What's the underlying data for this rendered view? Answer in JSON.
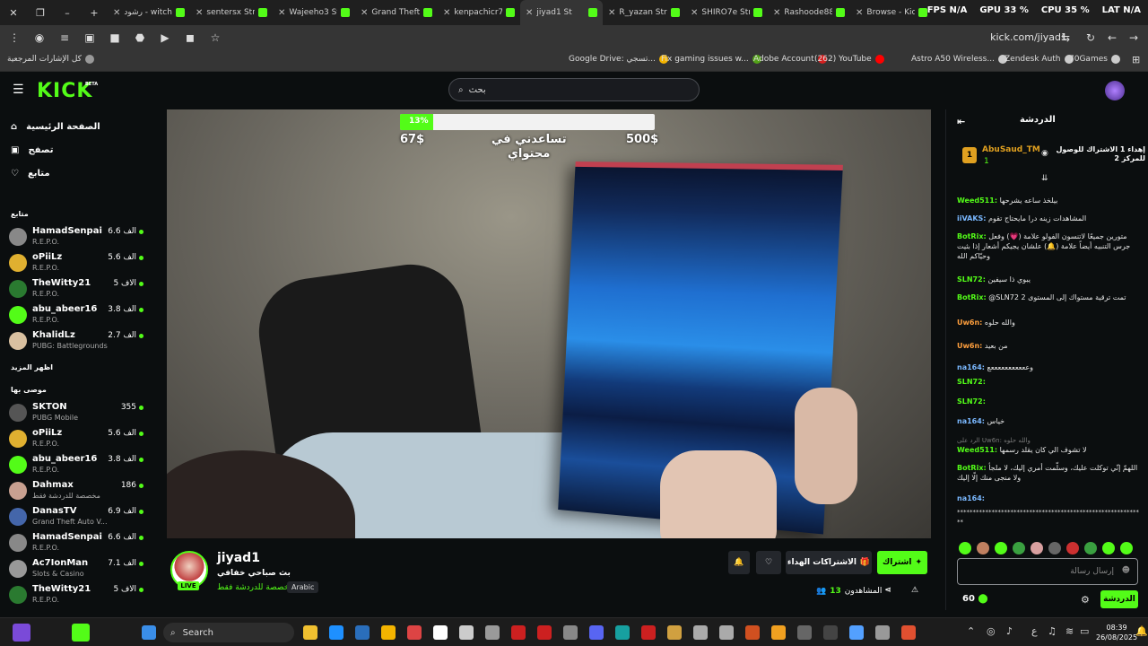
{
  "browser": {
    "tabs": [
      {
        "label": "رشود - witch",
        "active": false
      },
      {
        "label": "sentersx Stre",
        "active": false
      },
      {
        "label": "Wajeeho3 St",
        "active": false
      },
      {
        "label": "Grand Theft",
        "active": false
      },
      {
        "label": "kenpachicr7",
        "active": false
      },
      {
        "label": "jiyad1 St",
        "active": true
      },
      {
        "label": "R_yazan Stre",
        "active": false
      },
      {
        "label": "SHIRO7e Str",
        "active": false
      },
      {
        "label": "Rashoode88",
        "active": false
      },
      {
        "label": "Browse - Kic",
        "active": false
      }
    ],
    "perf": {
      "fps_label": "FPS",
      "fps": "N/A",
      "gpu_label": "GPU",
      "gpu": "33 %",
      "cpu_label": "CPU",
      "cpu": "35 %",
      "lat_label": "LAT",
      "lat": "N/A"
    },
    "url": "kick.com/jiyad1",
    "bookmarks": [
      {
        "label": "كل الإشارات المرجعية",
        "color": "#999999"
      },
      {
        "label": "Google Drive: تسجي...",
        "color": "#f4b400"
      },
      {
        "label": "Fix gaming issues w...",
        "color": "#53a318"
      },
      {
        "label": "Adobe Account",
        "color": "#d42020"
      },
      {
        "label": "(262) YouTube",
        "color": "#ff0000"
      },
      {
        "label": "Astro A50 Wireless...",
        "color": "#cccccc"
      },
      {
        "label": "Zendesk Auth",
        "color": "#cccccc"
      },
      {
        "label": "70Games",
        "color": "#cccccc"
      }
    ]
  },
  "kick": {
    "logo": "KICK",
    "beta": "BETA",
    "search_placeholder": "بحث"
  },
  "sidebar": {
    "nav": [
      {
        "label": "الصفحة الرئيسية",
        "icon": "home-icon"
      },
      {
        "label": "تصفح",
        "icon": "browse-icon"
      },
      {
        "label": "متابع",
        "icon": "heart-icon"
      }
    ],
    "following_title": "متابع",
    "following": [
      {
        "name": "HamadSenpai",
        "category": "R.E.P.O.",
        "viewers": "6.6 الف",
        "color": "#888888"
      },
      {
        "name": "oPiiLz",
        "category": "R.E.P.O.",
        "viewers": "5.6 الف",
        "color": "#e0b030"
      },
      {
        "name": "TheWitty21",
        "category": "R.E.P.O.",
        "viewers": "5 الاف",
        "color": "#2a7a30"
      },
      {
        "name": "abu_abeer16",
        "category": "R.E.P.O.",
        "viewers": "3.8 الف",
        "color": "#53fc18"
      },
      {
        "name": "KhalidLz",
        "category": "PUBG: Battlegrounds",
        "viewers": "2.7 الف",
        "color": "#d9c0a0"
      }
    ],
    "show_more": "اظهر المزيد",
    "recommended_title": "موصى بها",
    "recommended": [
      {
        "name": "SKTON",
        "category": "PUBG Mobile",
        "viewers": "355",
        "color": "#555555"
      },
      {
        "name": "oPiiLz",
        "category": "R.E.P.O.",
        "viewers": "5.6 الف",
        "color": "#e0b030"
      },
      {
        "name": "abu_abeer16",
        "category": "R.E.P.O.",
        "viewers": "3.8 الف",
        "color": "#53fc18"
      },
      {
        "name": "Dahmax",
        "category": "مخصصة للدردشة فقط",
        "viewers": "186",
        "color": "#c8a090"
      },
      {
        "name": "DanasTV",
        "category": "Grand Theft Auto V...",
        "viewers": "6.9 الف",
        "color": "#4466aa"
      },
      {
        "name": "HamadSenpai",
        "category": "R.E.P.O.",
        "viewers": "6.6 الف",
        "color": "#888888"
      },
      {
        "name": "Ac7IonMan",
        "category": "Slots & Casino",
        "viewers": "7.1 الف",
        "color": "#999999"
      },
      {
        "name": "TheWitty21",
        "category": "R.E.P.O.",
        "viewers": "5 الاف",
        "color": "#2a7a30"
      }
    ]
  },
  "video": {
    "goal_percent": 13,
    "goal_percent_label": "13%",
    "goal_current": "67$",
    "goal_target": "500$",
    "goal_text_line1": "تساعدني في",
    "goal_text_line2": "محتواي"
  },
  "stream": {
    "name": "jiyad1",
    "live": "LIVE",
    "title": "بث صباحي خفافي",
    "category": "مخصصة للدردشة فقط",
    "language": "Arabic",
    "follow_label": "اشتراك",
    "gift_label": "الاشتراكات الهداء",
    "viewers_label": "المشاهدون",
    "viewers": "13"
  },
  "chat": {
    "title": "الدردشة",
    "pinned_user": "AbuSaud_TM",
    "pinned_rank": "1",
    "pinned_count": "1",
    "pinned_text": "إهداء 1 الاشتراك للوصول للمركز 2",
    "messages": [
      {
        "user": "Weed511",
        "text": "بيلخذ ساعه يشرحها",
        "cls": ""
      },
      {
        "user": "iiVAKS",
        "text": "المشاهدات زينه درا مايحتاج تقوم",
        "cls": "u3"
      },
      {
        "user": "BotRix",
        "text": "متورين جميعًا لاتنسون الفولو علامة (💗) وفعل جرس التنبيه أيضاً علامة (🔔) علشان يجيكم أشعار إذا بثيت وحيّاكم الله",
        "cls": ""
      },
      {
        "user": "SLN72",
        "text": "يبوي ذا سيفين",
        "cls": ""
      },
      {
        "user": "BotRix",
        "text": "@SLN72 تمت ترقية مستواك إلى المستوى 2",
        "cls": ""
      },
      {
        "user": "Uw6n",
        "text": "والله حلوه",
        "cls": "u2"
      },
      {
        "user": "Uw6n",
        "text": "من بعيد",
        "cls": "u2"
      },
      {
        "user": "na164",
        "text": "وعععععععععععع",
        "cls": "u3"
      },
      {
        "user": "SLN72",
        "text": "",
        "cls": ""
      },
      {
        "user": "SLN72",
        "text": "",
        "cls": ""
      },
      {
        "user": "na164",
        "text": "خياس",
        "cls": "u3"
      },
      {
        "user": "Weed511",
        "text": "لا تشوف الي كان يقلد رسمها",
        "cls": ""
      },
      {
        "user": "BotRix",
        "text": "اللهمّ إنّي توكلت عليك، وسلّمت أمري إليك، لا ملجأ ولا منجى منك إلّا إليك",
        "cls": ""
      },
      {
        "user": "na164",
        "text": "",
        "cls": "u3"
      }
    ],
    "reply_hint": "الرد على Uw6n: والله حلوه",
    "stars": "************************************************************",
    "input_placeholder": "إرسال رسالة",
    "send_label": "الدردشة",
    "points": "60"
  },
  "taskbar": {
    "search": "Search",
    "time": "08:39",
    "date": "26/08/2025",
    "lang": "ع"
  }
}
